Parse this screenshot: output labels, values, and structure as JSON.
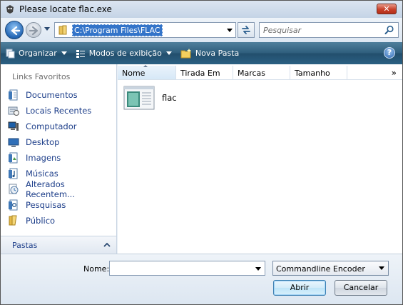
{
  "window": {
    "title": "Please locate flac.exe",
    "close_label": "✕"
  },
  "address": {
    "path": "C:\\Program Files\\FLAC"
  },
  "search": {
    "placeholder": "Pesquisar"
  },
  "toolbar": {
    "organize_label": "Organizar",
    "views_label": "Modos de exibição",
    "new_folder_label": "Nova Pasta",
    "help_label": "?"
  },
  "sidebar": {
    "heading": "Links Favoritos",
    "items": [
      {
        "label": "Documentos",
        "icon": "documents-icon"
      },
      {
        "label": "Locais Recentes",
        "icon": "recent-places-icon"
      },
      {
        "label": "Computador",
        "icon": "computer-icon"
      },
      {
        "label": "Desktop",
        "icon": "desktop-icon"
      },
      {
        "label": "Imagens",
        "icon": "pictures-icon"
      },
      {
        "label": "Músicas",
        "icon": "music-icon"
      },
      {
        "label": "Alterados Recentem...",
        "icon": "recently-changed-icon"
      },
      {
        "label": "Pesquisas",
        "icon": "searches-icon"
      },
      {
        "label": "Público",
        "icon": "public-folder-icon"
      }
    ],
    "folders_label": "Pastas"
  },
  "file_list": {
    "columns": [
      "Nome",
      "Tirada Em",
      "Marcas",
      "Tamanho"
    ],
    "more": "»",
    "items": [
      {
        "name": "flac",
        "icon": "executable-icon"
      }
    ]
  },
  "footer": {
    "name_label": "Nome:",
    "name_value": "",
    "file_type": "Commandline Encoder",
    "open_label": "Abrir",
    "cancel_label": "Cancelar"
  },
  "colors": {
    "toolbar": "#2e5d7c",
    "link_text": "#1e3f8a",
    "selection": "#3374c9"
  }
}
